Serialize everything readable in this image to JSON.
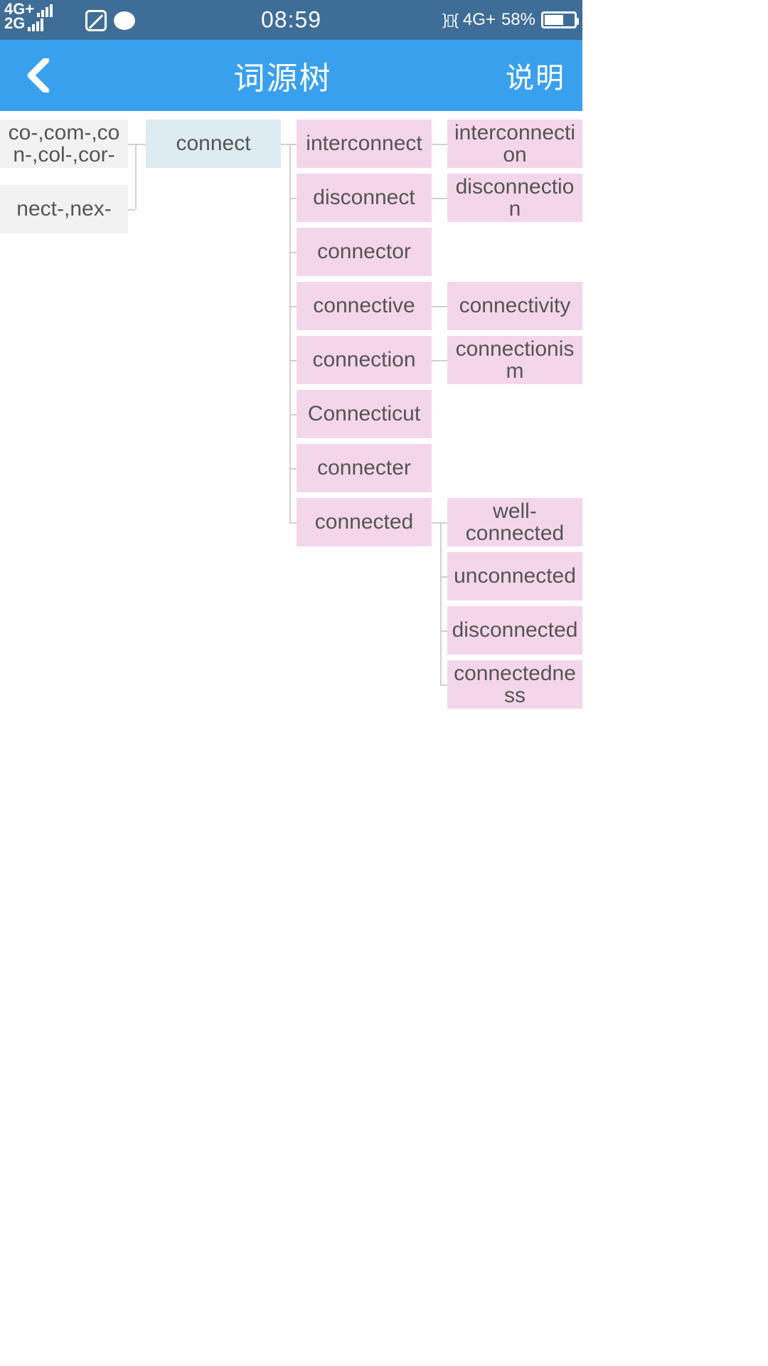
{
  "status": {
    "net1": "4G+",
    "net2": "2G",
    "time": "08:59",
    "right_net": "4G+",
    "battery_pct": "58%"
  },
  "header": {
    "title": "词源树",
    "help": "说明"
  },
  "tree": {
    "roots": [
      "co-,com-,con-,col-,cor-",
      "nect-,nex-"
    ],
    "main": "connect",
    "children": [
      {
        "word": "interconnect",
        "grand": [
          "interconnection"
        ]
      },
      {
        "word": "disconnect",
        "grand": [
          "disconnection"
        ]
      },
      {
        "word": "connector",
        "grand": []
      },
      {
        "word": "connective",
        "grand": [
          "connectivity"
        ]
      },
      {
        "word": "connection",
        "grand": [
          "connectionism"
        ]
      },
      {
        "word": "Connecticut",
        "grand": []
      },
      {
        "word": "connecter",
        "grand": []
      },
      {
        "word": "connected",
        "grand": [
          "well-connected",
          "unconnected",
          "disconnected",
          "connectedness"
        ]
      }
    ]
  }
}
